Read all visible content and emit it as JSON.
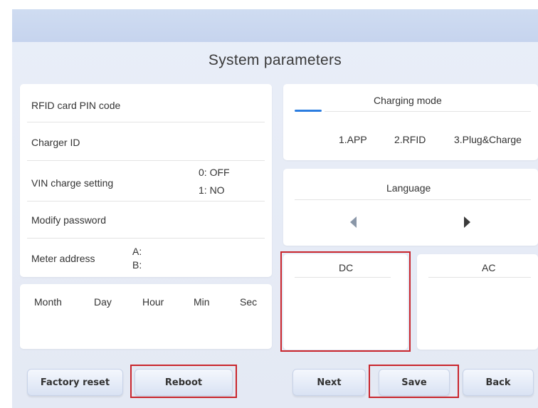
{
  "title": "System parameters",
  "left_panel": {
    "rfid_pin_label": "RFID card PIN code",
    "charger_id_label": "Charger ID",
    "vin_label": "VIN charge setting",
    "vin_option_0": "0: OFF",
    "vin_option_1": "1: NO",
    "modify_password_label": "Modify password",
    "meter_address_label": "Meter address",
    "meter_a": "A:",
    "meter_b": "B:"
  },
  "datetime": {
    "month": "Month",
    "day": "Day",
    "hour": "Hour",
    "min": "Min",
    "sec": "Sec"
  },
  "charging_mode": {
    "title": "Charging mode",
    "options": [
      "1.APP",
      "2.RFID",
      "3.Plug&Charge"
    ]
  },
  "language": {
    "title": "Language"
  },
  "dc_label": "DC",
  "ac_label": "AC",
  "buttons": {
    "factory_reset": "Factory reset",
    "reboot": "Reboot",
    "next": "Next",
    "save": "Save",
    "back": "Back"
  },
  "colors": {
    "accent": "#2b7de0",
    "highlight_box": "#c9252c",
    "background": "#e6ebf5",
    "topbar": "#c9d7ef"
  }
}
